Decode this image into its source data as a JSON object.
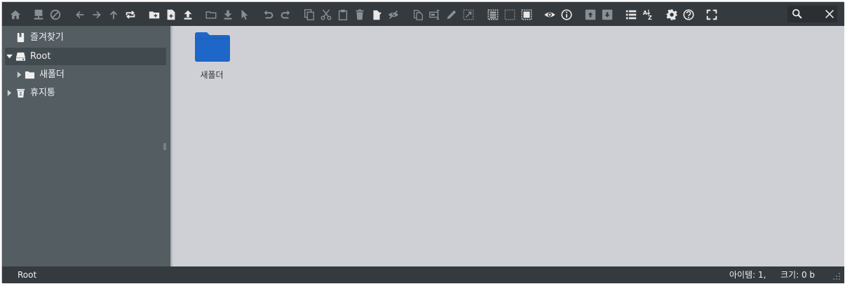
{
  "toolbar": {
    "icons": [
      "home-icon",
      "computer-icon",
      "cancel-icon",
      "back-icon",
      "forward-icon",
      "up-icon",
      "reload-icon",
      "new-folder-icon",
      "new-file-icon",
      "upload-icon",
      "open-folder-icon",
      "download-icon",
      "select-cursor-icon",
      "undo-icon",
      "redo-icon",
      "copy-icon",
      "cut-icon",
      "paste-icon",
      "delete-icon",
      "empty-icon",
      "hide-icon",
      "duplicate-icon",
      "rename-icon",
      "edit-icon",
      "resize-icon",
      "select-all-icon",
      "select-none-icon",
      "invert-selection-icon",
      "view-icon",
      "info-icon",
      "extract-icon",
      "archive-icon",
      "list-view-icon",
      "sort-icon",
      "preferences-icon",
      "help-icon",
      "fullscreen-icon"
    ],
    "search": {
      "value": "",
      "placeholder": ""
    }
  },
  "sidebar": {
    "items": [
      {
        "label": "즐겨찾기",
        "icon": "bookmark-icon",
        "expandable": false
      },
      {
        "label": "Root",
        "icon": "drive-icon",
        "expandable": true,
        "expanded": true,
        "selected": true
      },
      {
        "label": "새폴더",
        "icon": "folder-icon",
        "expandable": true,
        "expanded": false
      },
      {
        "label": "휴지통",
        "icon": "trash-icon",
        "expandable": true,
        "expanded": false
      }
    ]
  },
  "main": {
    "files": [
      {
        "name": "새폴더",
        "icon": "folder-icon"
      }
    ]
  },
  "statusbar": {
    "path": "Root",
    "items": "아이템: 1,",
    "size": "크기: 0 b"
  },
  "colors": {
    "toolbar_bg": "#353a3e",
    "sidebar_bg": "#535d62",
    "sidebar_selected": "#414a4f",
    "main_bg": "#cfd0d6",
    "folder_blue": "#1e66c8",
    "icon_active": "#e8e8e8",
    "icon_disabled": "#8a8f93"
  }
}
